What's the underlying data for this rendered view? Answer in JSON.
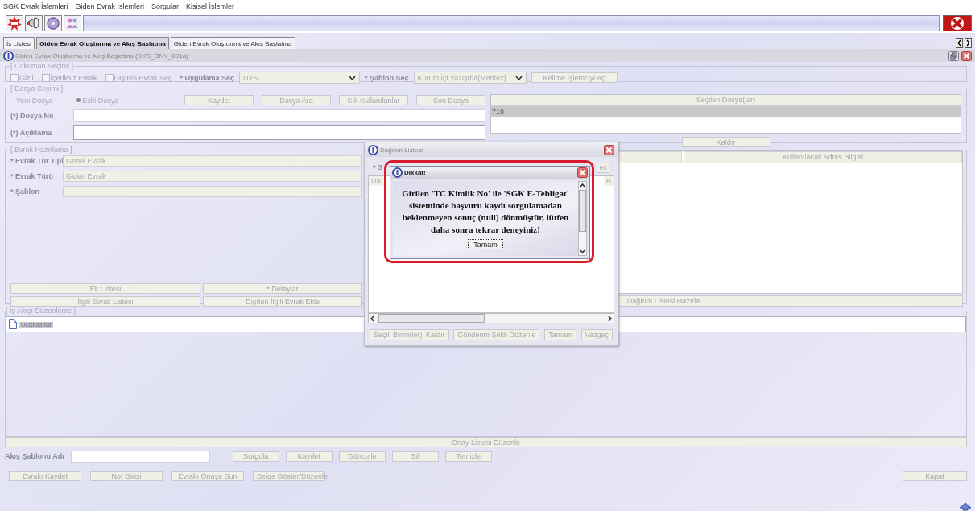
{
  "menu": [
    "SGK Evrak İslemleri",
    "Giden Evrak İslemleri",
    "Sorgular",
    "Kisisel İslemler"
  ],
  "tabs": [
    {
      "label": "İş Listesi",
      "selected": false
    },
    {
      "label": "Giden Evrak Oluşturma ve Akış Başlatma",
      "selected": true
    },
    {
      "label": "Giden Evrak Oluşturma ve Akış Başlatma",
      "selected": false
    }
  ],
  "frame_title": "Giden Evrak Oluşturma ve Akış Başlatma (DYS_ONY_001a)",
  "document_selection": {
    "legend": "[ Doküman Seçimi ]",
    "checkboxes": [
      {
        "label": "Gizli",
        "checked": false
      },
      {
        "label": "İçeriksiz Evrak",
        "checked": false
      },
      {
        "label": "Dışıten Evrak Seç",
        "checked": false
      }
    ],
    "application_label": "* Uygulama Seç",
    "application_value": "DYS",
    "template_label": "* Şablon Seç",
    "template_value": "Kurum İçi Yazışma(Merkez)",
    "word_button": "Kelime İşlemciyi Aç"
  },
  "file_selection": {
    "legend": "[ Dosya Seçimi ]",
    "radios": [
      {
        "label": "Yeni Dosya",
        "selected": false
      },
      {
        "label": "Eski Dosya",
        "selected": true
      }
    ],
    "buttons": [
      "Kaydet",
      "Dosya Ara",
      "Sık Kullanılanlar",
      "Son Dosya"
    ],
    "fields": [
      {
        "label": "(*) Dosya No",
        "kind": "single"
      },
      {
        "label": "(*) Açıklama",
        "kind": "multi"
      }
    ],
    "selected_files": {
      "header": "Seçilen Dosya(lar)",
      "rows": [
        {
          "value": "719",
          "selected": true
        }
      ]
    },
    "remove_button": "Kaldır"
  },
  "document_preparation": {
    "legend": "[ Evrak Hazırlama ]",
    "fields": [
      {
        "label": "* Evrak Tür Tipi",
        "value": "Genel Evrak"
      },
      {
        "label": "* Evrak Türü",
        "value": "Giden Evrak"
      },
      {
        "label": "* Şablon"
      }
    ],
    "buttons": [
      "Ek Listesi",
      "* Detaylar",
      "İlgili Evrak Listesi",
      "Dışıten İlgili Evrak Ekle"
    ],
    "distribution_columns": [
      "Kullanılacak Adres Bilgisi"
    ],
    "prepare_button": "Dağıtım Listesi Hazırla"
  },
  "workflow": {
    "legend": "[ İş Akışı Düzenleme ]",
    "tree": [
      {
        "label": "Oluşturanlar",
        "selected": true
      }
    ],
    "approval_button": "Onay Listesi Düzenle",
    "template_label": "Akış Şablonu Adı",
    "template_buttons": [
      "Sorgula",
      "Kaydet",
      "Güncelle",
      "Sil",
      "Temizle"
    ]
  },
  "footer_buttons": [
    "Evrakı Kaydet",
    "Not Girişi",
    "Evrakı Onaya Sun",
    "Belge Göster/Düzenle"
  ],
  "close_button": "Kapat",
  "distribution_dialog": {
    "title": "Dağıtım Listesi",
    "partial_label": "* S",
    "partial_button": "eç",
    "columns": [
      "Da",
      "B"
    ],
    "buttons": [
      "Seçili Birim(ler)i Kaldır",
      "Gönderim Şekli Düzenle",
      "Tamam",
      "Vazgeç"
    ]
  },
  "alert": {
    "title": "Dikkat!",
    "message": "Girilen 'TC Kimlik No' ile 'SGK E-Tebligat' sisteminde başvuru kaydı sorgulamadan beklenmeyen sonuç (null) dönmüştür, lütfen daha sonra tekrar deneyiniz!",
    "ok_button": "Tamam"
  }
}
